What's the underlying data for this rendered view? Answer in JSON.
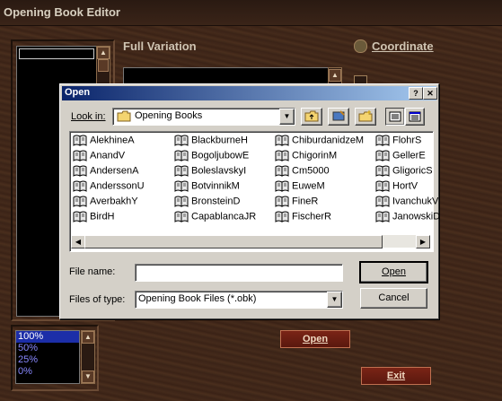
{
  "app": {
    "title": "Opening Book Editor",
    "full_variation_label": "Full Variation",
    "coordinate_label": "Coordinate",
    "open_button": "Open",
    "exit_button": "Exit"
  },
  "zoom": {
    "options": [
      "100%",
      "50%",
      "25%",
      "0%"
    ],
    "selected": "100%"
  },
  "dialog": {
    "title": "Open",
    "help_btn": "?",
    "close_btn": "✕",
    "look_in_label": "Look in:",
    "look_in_value": "Opening Books",
    "files": [
      [
        "AlekhineA",
        "BlackburneH",
        "ChiburdanidzeM",
        "FlohrS"
      ],
      [
        "AnandV",
        "BogoljubowE",
        "ChigorinM",
        "GellerE"
      ],
      [
        "AndersenA",
        "BoleslavskyI",
        "Cm5000",
        "GligoricS"
      ],
      [
        "AnderssonU",
        "BotvinnikM",
        "EuweM",
        "HortV"
      ],
      [
        "AverbakhY",
        "BronsteinD",
        "FineR",
        "IvanchukV"
      ],
      [
        "BirdH",
        "CapablancaJR",
        "FischerR",
        "JanowskiD"
      ]
    ],
    "file_name_label": "File name:",
    "file_name_value": "",
    "files_of_type_label": "Files of type:",
    "files_of_type_value": "Opening Book Files (*.obk)",
    "open_button": "Open",
    "cancel_button": "Cancel"
  },
  "colors": {
    "dialog_title": "#0a246a",
    "wood_button": "#7a2416",
    "zoom_selected": "#1c2ea8"
  }
}
